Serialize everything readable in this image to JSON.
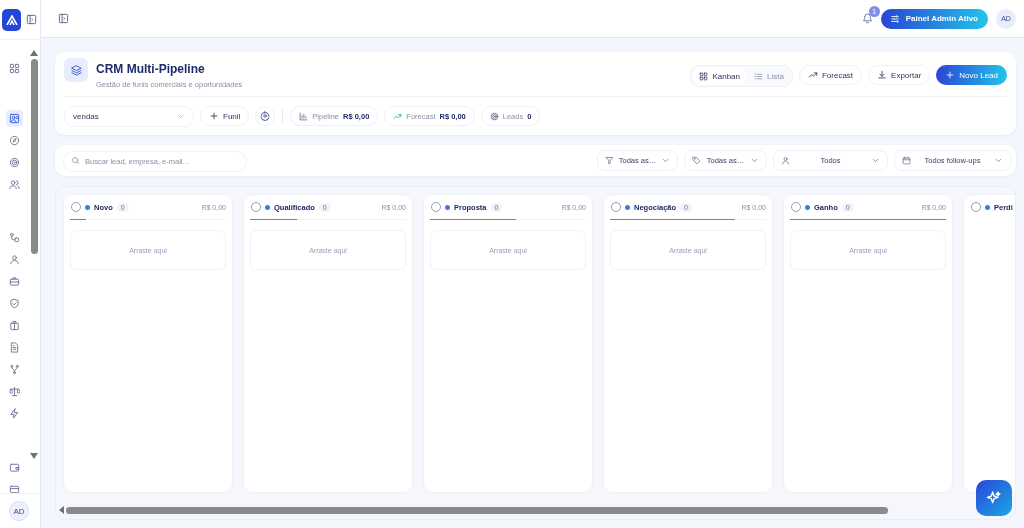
{
  "sidebar": {
    "groups": [
      {
        "items": [
          {
            "selected": false
          }
        ]
      },
      {
        "items": [
          {
            "selected": true
          },
          {
            "selected": false
          },
          {
            "selected": false
          },
          {
            "selected": false
          }
        ]
      },
      {
        "items": [
          {
            "selected": false
          },
          {
            "selected": false
          },
          {
            "selected": false
          },
          {
            "selected": false
          },
          {
            "selected": false
          },
          {
            "selected": false
          },
          {
            "selected": false
          },
          {
            "selected": false
          },
          {
            "selected": false
          }
        ]
      },
      {
        "items": [
          {
            "selected": false
          },
          {
            "selected": false
          }
        ]
      }
    ],
    "avatar": "AD"
  },
  "topbar": {
    "notifications": "1",
    "admin_button": "Painel Admin Ativo",
    "avatar": "AD"
  },
  "header": {
    "title": "CRM Multi-Pipeline",
    "subtitle": "Gestão de funis comerciais e oportunidades",
    "views": [
      {
        "label": "Kanban",
        "selected": true
      },
      {
        "label": "Lista",
        "selected": false
      }
    ],
    "actions": [
      {
        "label": "Forecast",
        "kind": "plain"
      },
      {
        "label": "Exportar",
        "kind": "plain"
      },
      {
        "label": "Novo Lead",
        "kind": "primary"
      }
    ],
    "pipeline_select": "vendas",
    "add_funnel": "Funil",
    "stats": [
      {
        "label": "Pipeline",
        "value": "R$ 0,00"
      },
      {
        "label": "Forecast",
        "value": "R$ 0,00"
      },
      {
        "label": "Leads",
        "value": "0"
      }
    ]
  },
  "filters": {
    "search": {
      "placeholder": "Buscar lead, empresa, e-mail..."
    },
    "selects": [
      {
        "value": "Todas as…"
      },
      {
        "value": "Todas as…"
      },
      {
        "value": "Todos"
      },
      {
        "value": "Todos follow-ups"
      }
    ]
  },
  "columns": [
    {
      "name": "Novo",
      "count": "0",
      "total": "R$ 0,00",
      "checked": false,
      "level": 0.1,
      "empty": "Arraste aqui"
    },
    {
      "name": "Qualificado",
      "count": "0",
      "total": "R$ 0,00",
      "checked": false,
      "level": 0.3,
      "empty": "Arraste aqui"
    },
    {
      "name": "Proposta",
      "count": "0",
      "total": "R$ 0,00",
      "checked": false,
      "level": 0.55,
      "empty": "Arraste aqui"
    },
    {
      "name": "Negociação",
      "count": "0",
      "total": "R$ 0,00",
      "checked": false,
      "level": 0.8,
      "empty": "Arraste aqui"
    },
    {
      "name": "Ganho",
      "count": "0",
      "total": "R$ 0,00",
      "checked": false,
      "level": 1,
      "empty": "Arraste aqui"
    },
    {
      "name": "Perdi",
      "checked": false
    }
  ]
}
